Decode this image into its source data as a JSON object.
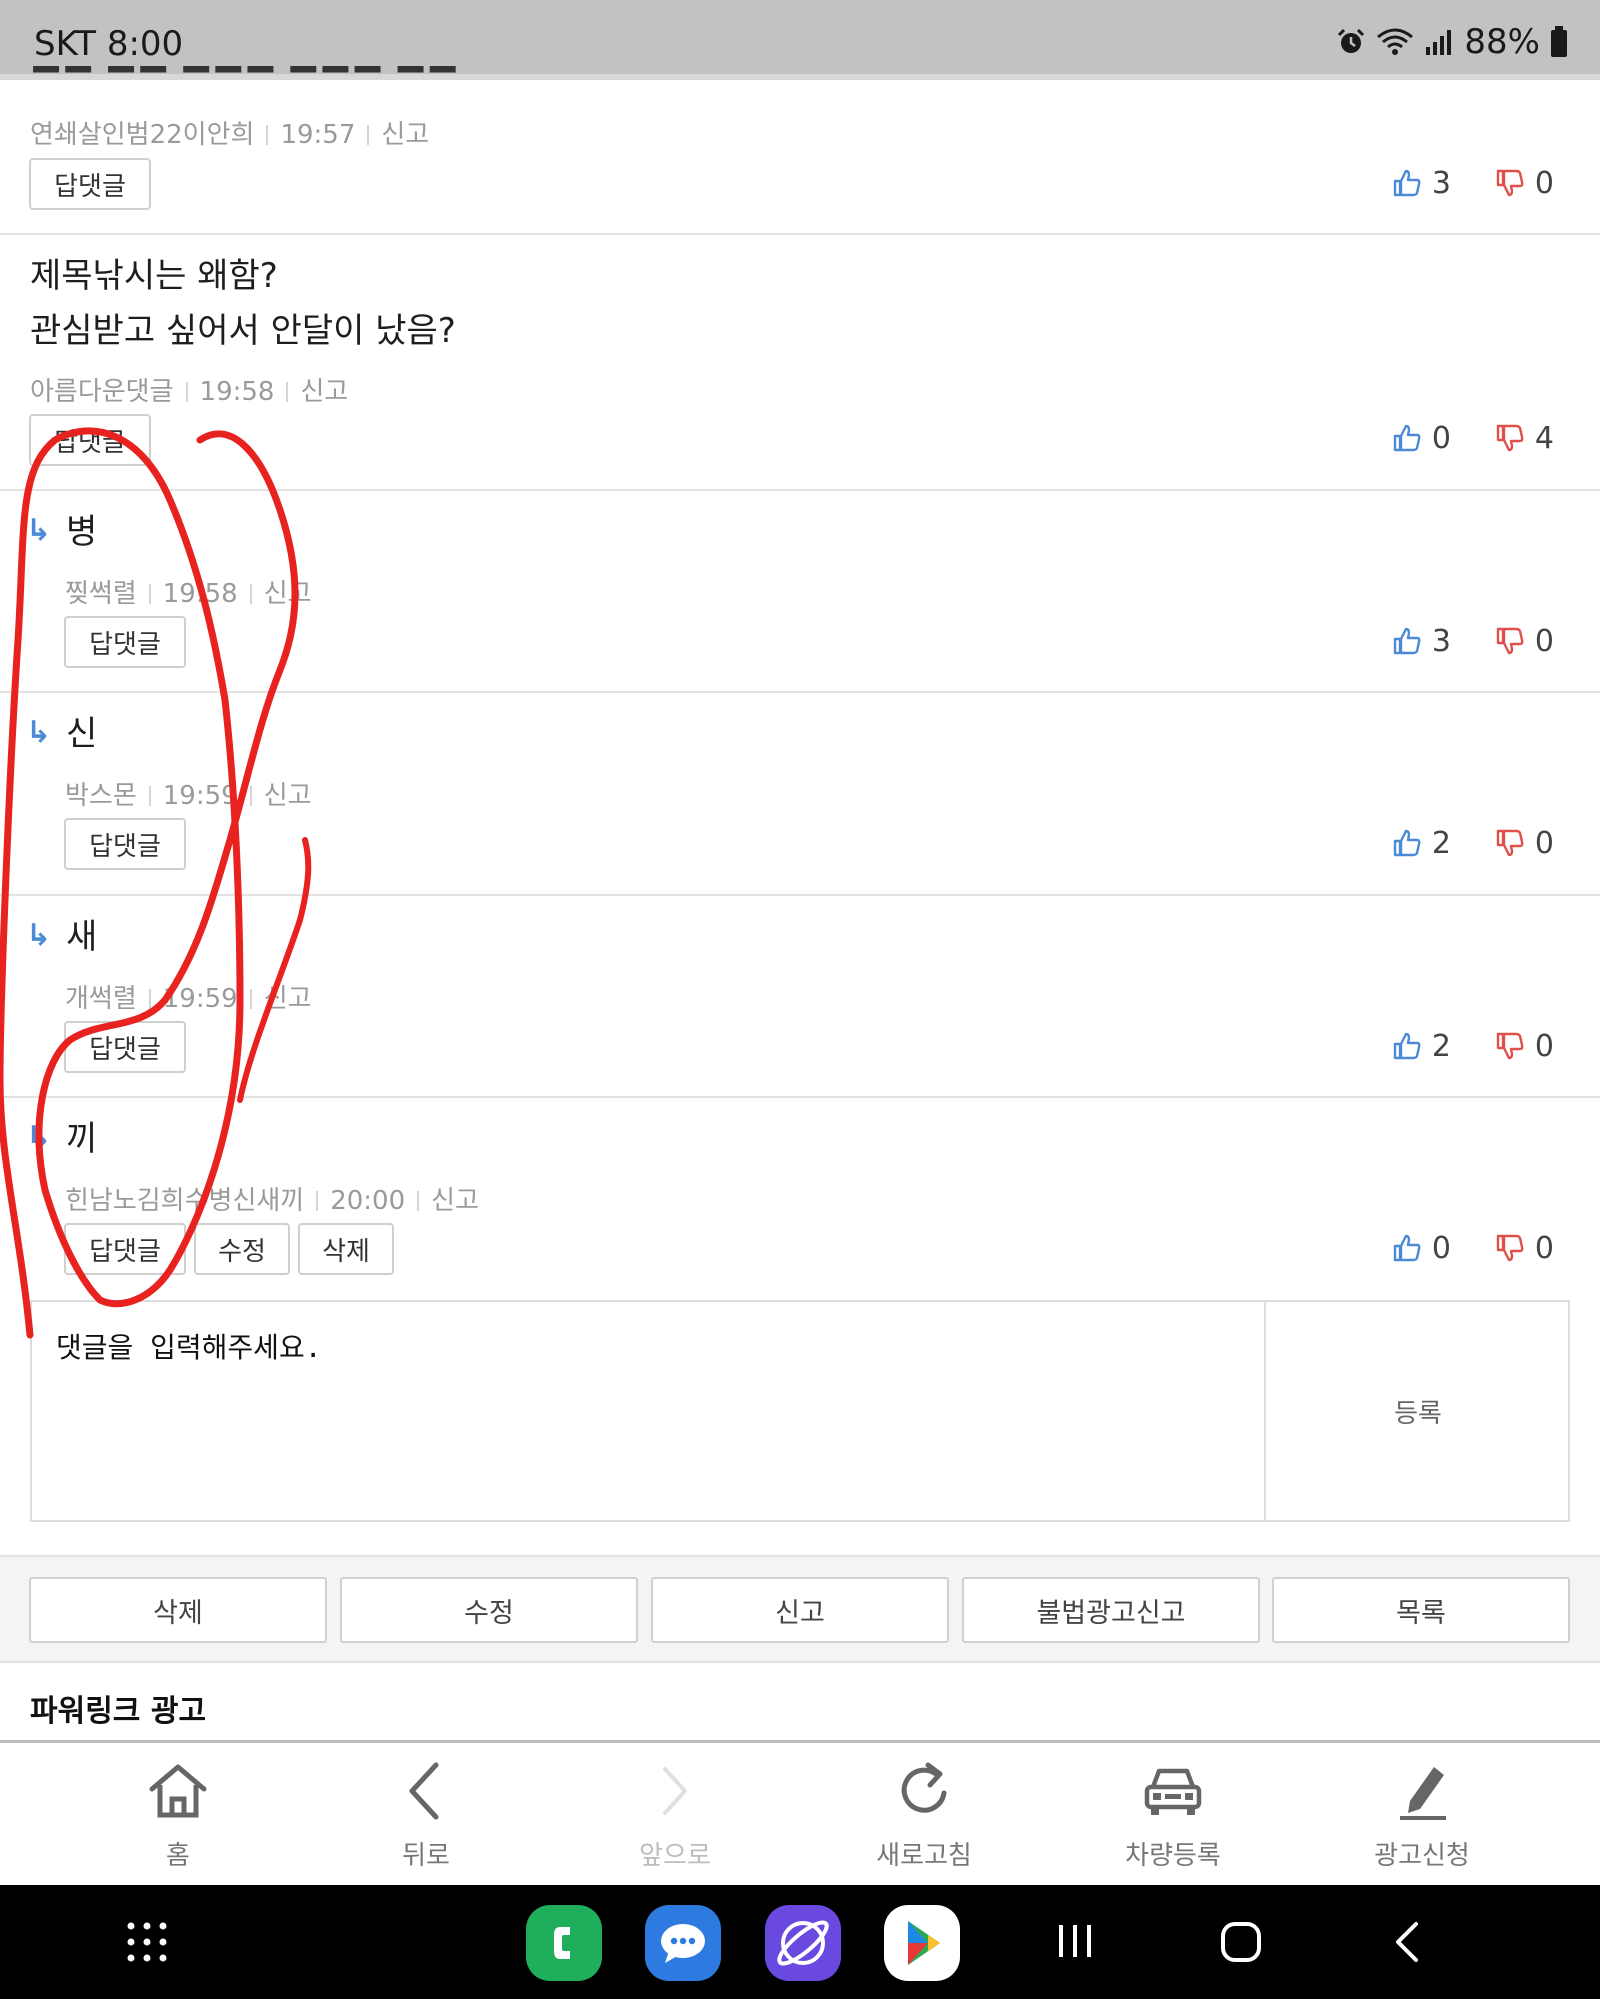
{
  "status_bar": {
    "carrier_time": "SKT 8:00",
    "battery": "88%",
    "icons": [
      "alarm-icon",
      "wifi-icon",
      "signal-icon",
      "battery-icon"
    ]
  },
  "comments": [
    {
      "text_lines": [],
      "author": "연쇄살인범22이안희",
      "time": "19:57",
      "report": "신고",
      "buttons": [
        "답댓글"
      ],
      "likes": "3",
      "dislikes": "0",
      "reply": false
    },
    {
      "text_lines": [
        "제목낚시는 왜함?",
        "관심받고 싶어서 안달이 났음?"
      ],
      "author": "아름다운댓글",
      "time": "19:58",
      "report": "신고",
      "buttons": [
        "답댓글"
      ],
      "likes": "0",
      "dislikes": "4",
      "reply": false
    },
    {
      "text_lines": [
        "병"
      ],
      "author": "찢썩렬",
      "time": "19:58",
      "report": "신고",
      "buttons": [
        "답댓글"
      ],
      "likes": "3",
      "dislikes": "0",
      "reply": true
    },
    {
      "text_lines": [
        "신"
      ],
      "author": "박스몬",
      "time": "19:59",
      "report": "신고",
      "buttons": [
        "답댓글"
      ],
      "likes": "2",
      "dislikes": "0",
      "reply": true
    },
    {
      "text_lines": [
        "새"
      ],
      "author": "개썩렬",
      "time": "19:59",
      "report": "신고",
      "buttons": [
        "답댓글"
      ],
      "likes": "2",
      "dislikes": "0",
      "reply": true
    },
    {
      "text_lines": [
        "끼"
      ],
      "author": "힌남노김희수병신새끼",
      "time": "20:00",
      "report": "신고",
      "buttons": [
        "답댓글",
        "수정",
        "삭제"
      ],
      "likes": "0",
      "dislikes": "0",
      "reply": true
    }
  ],
  "comment_form": {
    "placeholder": "댓글을 입력해주세요.",
    "submit": "등록"
  },
  "action_bar": [
    "삭제",
    "수정",
    "신고",
    "불법광고신고",
    "목록"
  ],
  "powerlink_title": "파워링크 광고",
  "bottom_nav": [
    {
      "label": "홈",
      "icon": "home-icon",
      "enabled": true
    },
    {
      "label": "뒤로",
      "icon": "back-icon",
      "enabled": true
    },
    {
      "label": "앞으로",
      "icon": "forward-icon",
      "enabled": false
    },
    {
      "label": "새로고침",
      "icon": "refresh-icon",
      "enabled": true
    },
    {
      "label": "차량등록",
      "icon": "car-icon",
      "enabled": true
    },
    {
      "label": "광고신청",
      "icon": "pencil-icon",
      "enabled": true
    }
  ],
  "android_nav": {
    "apps": [
      "phone-app-icon",
      "messages-app-icon",
      "internet-app-icon",
      "play-store-icon"
    ],
    "buttons": [
      "app-drawer-icon",
      "recents-icon",
      "home-button-icon",
      "back-button-icon"
    ]
  },
  "colors": {
    "like": "#4a8ad6",
    "dislike": "#e0504a",
    "annotation": "#e8231f"
  }
}
